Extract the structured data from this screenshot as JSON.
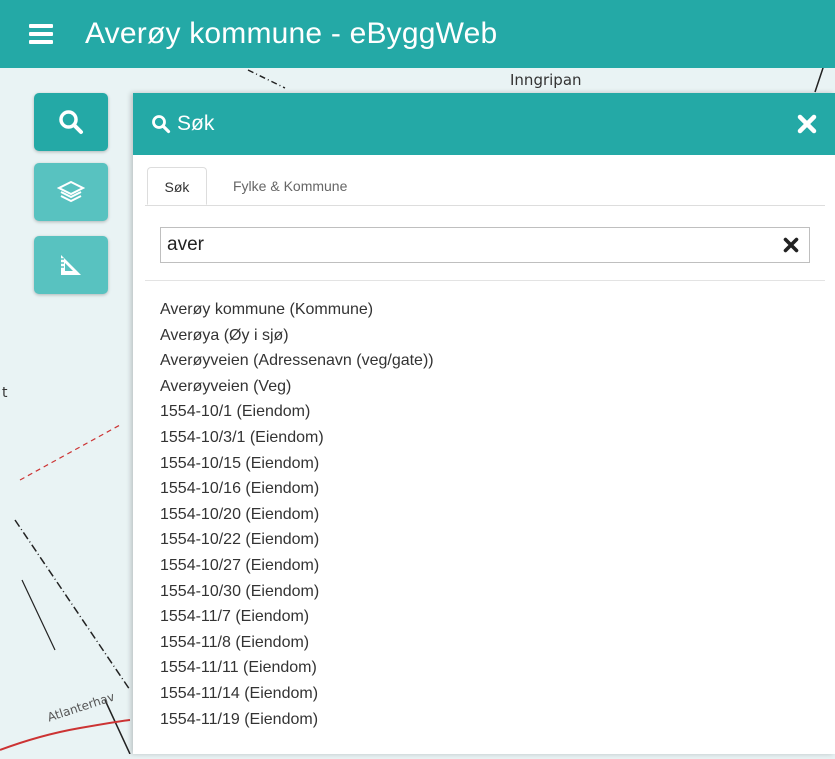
{
  "app": {
    "title": "Averøy kommune - eByggWeb"
  },
  "map": {
    "labels": {
      "place_1": "Inngripan",
      "place_2": "Atlanterhav",
      "edge_char": "t"
    }
  },
  "tools": [
    "search-icon",
    "layers-icon",
    "measure-icon"
  ],
  "panel": {
    "title": "Søk",
    "tabs": [
      {
        "label": "Søk",
        "active": true
      },
      {
        "label": "Fylke & Kommune",
        "active": false
      }
    ],
    "search": {
      "value": "aver"
    },
    "results": [
      "Averøy kommune (Kommune)",
      "Averøya (Øy i sjø)",
      "Averøyveien (Adressenavn (veg/gate))",
      "Averøyveien (Veg)",
      "1554-10/1 (Eiendom)",
      "1554-10/3/1 (Eiendom)",
      "1554-10/15 (Eiendom)",
      "1554-10/16 (Eiendom)",
      "1554-10/20 (Eiendom)",
      "1554-10/22 (Eiendom)",
      "1554-10/27 (Eiendom)",
      "1554-10/30 (Eiendom)",
      "1554-11/7 (Eiendom)",
      "1554-11/8 (Eiendom)",
      "1554-11/11 (Eiendom)",
      "1554-11/14 (Eiendom)",
      "1554-11/19 (Eiendom)"
    ]
  },
  "colors": {
    "primary": "#24a9a6",
    "primary_light": "#58c2c0"
  }
}
